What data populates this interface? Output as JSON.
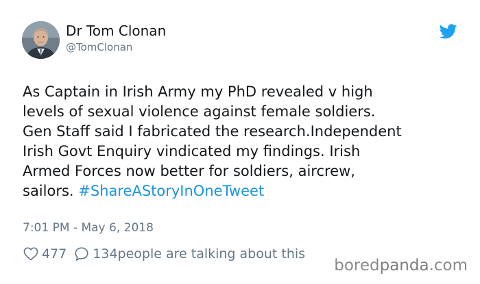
{
  "author": {
    "name": "Dr Tom Clonan",
    "handle": "@TomClonan",
    "avatar_icon": "profile-photo"
  },
  "platform_icon": "twitter-bird-icon",
  "colors": {
    "brand": "#1da1f2",
    "hashtag": "#1b95e0",
    "meta": "#657786",
    "text": "#14171a"
  },
  "tweet": {
    "text": "As Captain in Irish Army my PhD revealed v high\nlevels of sexual violence against female soldiers.\nGen Staff said I fabricated the research.Independent\nIrish Govt Enquiry vindicated my findings. Irish\nArmed Forces now better for soldiers, aircrew,\nsailors. ",
    "hashtag": "#ShareAStoryInOneTweet",
    "time": "7:01 PM",
    "separator": " - ",
    "date": "May 6, 2018"
  },
  "stats": {
    "likes": "477",
    "replies": "134",
    "replies_label": " people are talking about this"
  },
  "watermark": {
    "part1": "bored",
    "part2": "panda",
    "part3": ".com"
  }
}
